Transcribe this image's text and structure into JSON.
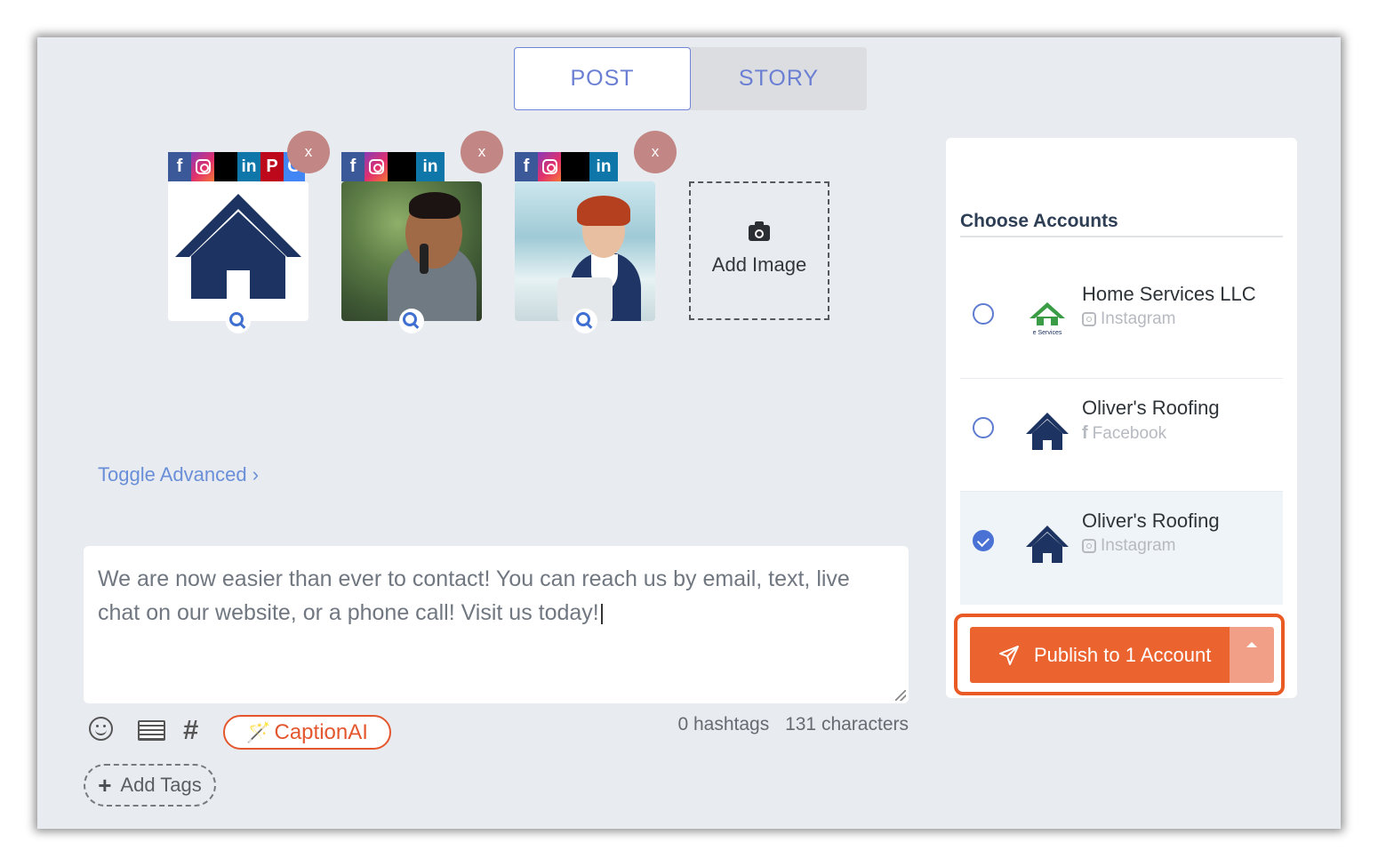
{
  "tabs": {
    "post": "POST",
    "story": "STORY"
  },
  "media": {
    "items": [
      {
        "kind": "house-logo",
        "networks": [
          "facebook",
          "instagram",
          "x",
          "linkedin",
          "pinterest",
          "google"
        ]
      },
      {
        "kind": "man-photo",
        "networks": [
          "facebook",
          "instagram",
          "x",
          "linkedin"
        ]
      },
      {
        "kind": "woman-photo",
        "networks": [
          "facebook",
          "instagram",
          "x",
          "linkedin"
        ]
      }
    ],
    "remove_label": "x",
    "add_image_label": "Add Image"
  },
  "advanced": {
    "toggle_label": "Toggle Advanced ›"
  },
  "caption": {
    "text": "We are now easier than ever to contact! You can reach us by email, text, live chat on our website, or a phone call! Visit us today!"
  },
  "toolbar": {
    "captionai_label": "CaptionAI",
    "hash_glyph": "#",
    "hashtags_count": "0 hashtags",
    "characters_count": "131 characters",
    "add_tags_label": "Add Tags"
  },
  "accounts": {
    "title": "Choose Accounts",
    "items": [
      {
        "name": "Home Services LLC",
        "network": "Instagram",
        "checked": false,
        "logo_text": "e Services"
      },
      {
        "name": "Oliver's Roofing",
        "network": "Facebook",
        "checked": false
      },
      {
        "name": "Oliver's Roofing",
        "network": "Instagram",
        "checked": true
      }
    ]
  },
  "publish": {
    "label": "Publish to 1 Account"
  },
  "colors": {
    "accent": "#6a7fd4",
    "publish": "#eb6430",
    "navy": "#1d3361"
  }
}
